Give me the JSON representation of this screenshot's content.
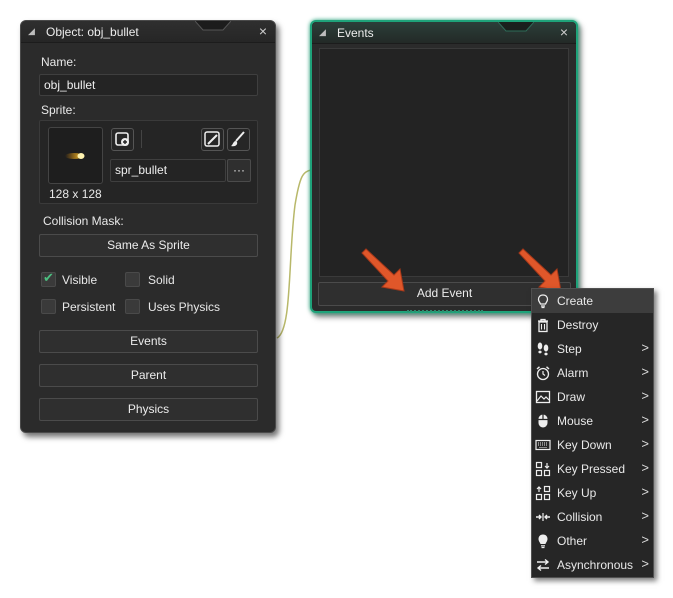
{
  "object_panel": {
    "title": "Object: obj_bullet",
    "name_label": "Name:",
    "name_value": "obj_bullet",
    "sprite_label": "Sprite:",
    "sprite_name": "spr_bullet",
    "sprite_dims": "128 x 128",
    "more_label": "···",
    "collision_label": "Collision Mask:",
    "collision_value": "Same As Sprite",
    "checkboxes": [
      {
        "label": "Visible",
        "checked": true
      },
      {
        "label": "Solid",
        "checked": false
      },
      {
        "label": "Persistent",
        "checked": false
      },
      {
        "label": "Uses Physics",
        "checked": false
      }
    ],
    "buttons": {
      "events": "Events",
      "parent": "Parent",
      "physics": "Physics"
    },
    "close": "×"
  },
  "events_panel": {
    "title": "Events",
    "add_event_label": "Add Event",
    "close": "×"
  },
  "event_menu": {
    "items": [
      {
        "label": "Create",
        "icon": "lightbulb-outline-icon",
        "submenu": false,
        "highlighted": true
      },
      {
        "label": "Destroy",
        "icon": "trash-icon",
        "submenu": false
      },
      {
        "label": "Step",
        "icon": "footsteps-icon",
        "submenu": true
      },
      {
        "label": "Alarm",
        "icon": "alarm-clock-icon",
        "submenu": true
      },
      {
        "label": "Draw",
        "icon": "image-icon",
        "submenu": true
      },
      {
        "label": "Mouse",
        "icon": "mouse-icon",
        "submenu": true
      },
      {
        "label": "Key Down",
        "icon": "keyboard-icon",
        "submenu": true
      },
      {
        "label": "Key Pressed",
        "icon": "key-pressed-icon",
        "submenu": true
      },
      {
        "label": "Key Up",
        "icon": "key-up-icon",
        "submenu": true
      },
      {
        "label": "Collision",
        "icon": "collision-arrows-icon",
        "submenu": true
      },
      {
        "label": "Other",
        "icon": "lightbulb-filled-icon",
        "submenu": true
      },
      {
        "label": "Asynchronous",
        "icon": "swap-arrows-icon",
        "submenu": true
      }
    ],
    "submenu_glyph": ">"
  },
  "colors": {
    "panel_bg": "#2b2b2b",
    "events_accent": "#1fa37a",
    "arrow": "#e0572a",
    "check": "#4cc080"
  }
}
